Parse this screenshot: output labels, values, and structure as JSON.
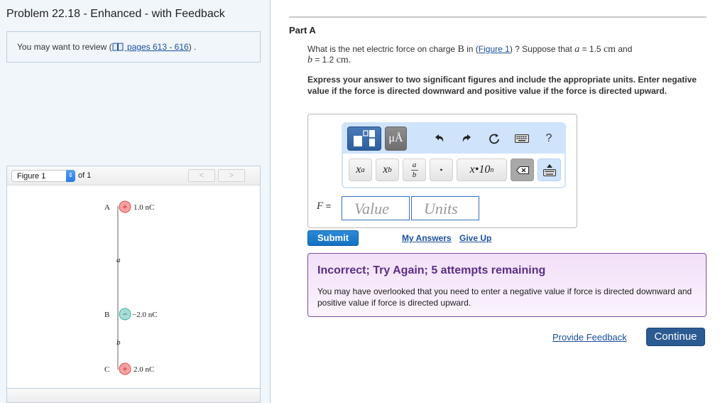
{
  "left": {
    "problem_title": "Problem 22.18 - Enhanced - with Feedback",
    "review_prefix": "You may want to review (",
    "review_link": " pages 613 - 616",
    "review_suffix": ") .",
    "figure_select": "Figure 1",
    "figure_of": "of 1",
    "prev_label": "<",
    "next_label": ">",
    "figure": {
      "charges": [
        {
          "point": "A",
          "sign": "+",
          "label": "1.0 nC"
        },
        {
          "point": "B",
          "sign": "−",
          "label": "−2.0 nC"
        },
        {
          "point": "C",
          "sign": "+",
          "label": "2.0 nC"
        }
      ],
      "distance_labels": [
        "a",
        "b"
      ],
      "colors": {
        "positive": "#f4a3a3",
        "positive_stroke": "#e0504f",
        "negative": "#a7dcd6",
        "negative_stroke": "#3fb0a5"
      }
    }
  },
  "part": {
    "title": "Part A",
    "question_1": "What is the net electric force on charge ",
    "question_B": "B",
    "question_2": " in (",
    "figure_link": "Figure 1",
    "question_3": ") ? Suppose that ",
    "var_a": "a",
    "question_4": " = 1.5 ",
    "unit_cm": "cm",
    "question_5": " and",
    "var_b": "b",
    "question_6": " = 1.2 ",
    "unit_cm2": "cm.",
    "instructions": "Express your answer to two significant figures and include the appropriate units. Enter negative value if the force is directed downward and positive value if the force is directed upward."
  },
  "editor": {
    "units_button": "μÅ",
    "help": "?",
    "keys": {
      "superscript": "xa",
      "subscript": "xb",
      "fraction_top": "a",
      "fraction_bottom": "b",
      "dot": "•",
      "sci": "x•10",
      "sci_exp": "n"
    },
    "f_label": "F",
    "f_eq": " =",
    "value_placeholder": "Value",
    "units_placeholder": "Units"
  },
  "actions": {
    "submit": "Submit",
    "my_answers": "My Answers",
    "give_up": "Give Up"
  },
  "feedback": {
    "title": "Incorrect; Try Again; 5 attempts remaining",
    "text": "You may have overlooked that you need to enter a negative value if force is directed downward and positive value if force is directed upward."
  },
  "footer": {
    "provide_feedback": "Provide Feedback",
    "continue": "Continue"
  }
}
